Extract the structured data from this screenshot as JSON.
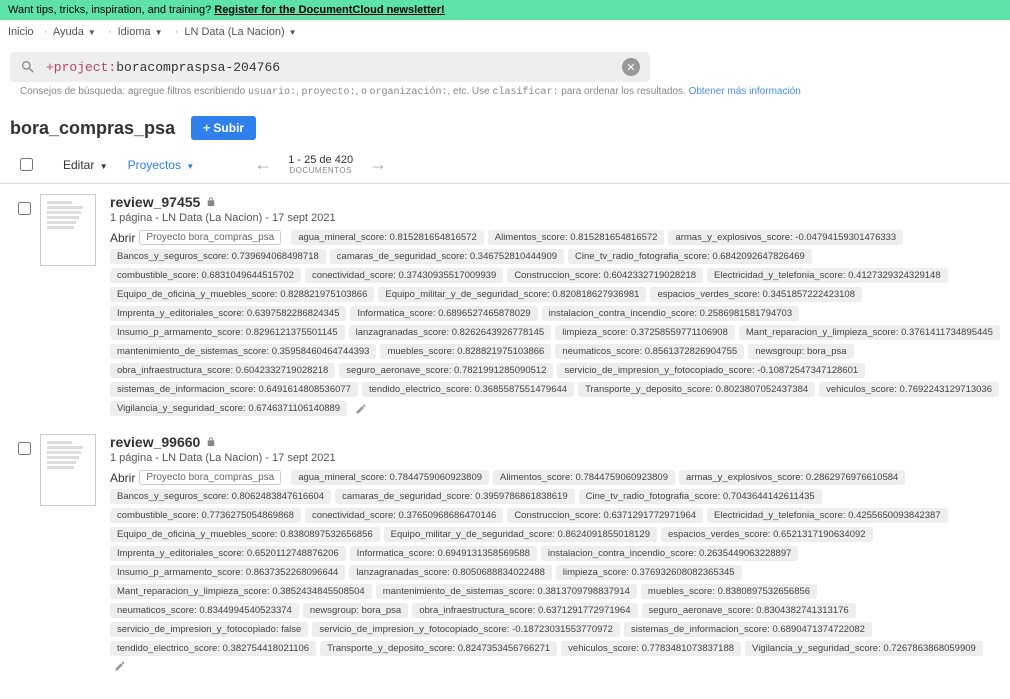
{
  "banner": {
    "text": "Want tips, tricks, inspiration, and training? ",
    "link": "Register for the DocumentCloud newsletter!"
  },
  "breadcrumb": {
    "home": "Inicio",
    "help": "Ayuda",
    "lang": "Idioma",
    "org": "LN Data (La Nacion)"
  },
  "search": {
    "prefix": "+project:",
    "value": "boracompraspsa-204766"
  },
  "hint": {
    "prefix": "Consejos de búsqueda: agregue filtros escribiendo ",
    "f1": "usuario:",
    "f2": "proyecto:",
    "mid": ", o ",
    "f3": "organización:",
    "mid2": ", etc. Use ",
    "f4": "clasificar:",
    "suffix": " para ordenar los resultados. ",
    "link": "Obtener más información"
  },
  "project": {
    "title": "bora_compras_psa",
    "upload": "+ Subir"
  },
  "toolbar": {
    "edit": "Editar",
    "projects": "Proyectos",
    "range": "1 - 25 de 420",
    "docs_label": "DOCUMENTOS"
  },
  "docs": [
    {
      "title": "review_97455",
      "meta": "1 página - LN Data (La Nacion) - 17 sept 2021",
      "open": "Abrir",
      "proj_label": "Proyecto",
      "proj_name": "bora_compras_psa",
      "tags": [
        "agua_mineral_score: 0.815281654816572",
        "Alimentos_score: 0.815281654816572",
        "armas_y_explosivos_score: -0.04794159301476333",
        "Bancos_y_seguros_score: 0.739694068498718",
        "camaras_de_seguridad_score: 0.346752810444909",
        "Cine_tv_radio_fotografia_score: 0.6842092647826469",
        "combustible_score: 0.6831049644515702",
        "conectividad_score: 0.37430935517009939",
        "Construccion_score: 0.6042332719028218",
        "Electricidad_y_telefonia_score: 0.4127329324329148",
        "Equipo_de_oficina_y_muebles_score: 0.828821975103866",
        "Equipo_militar_y_de_seguridad_score: 0.820818627936981",
        "espacios_verdes_score: 0.3451857222423108",
        "Imprenta_y_editoriales_score: 0.6397582286824345",
        "Informatica_score: 0.6896527465878029",
        "instalacion_contra_incendio_score: 0.2586981581794703",
        "Insumo_p_armamento_score: 0.8296121375501145",
        "lanzagranadas_score: 0.8262643926778145",
        "limpieza_score: 0.37258559771106908",
        "Mant_reparacion_y_limpieza_score: 0.3761411734895445",
        "mantenimiento_de_sistemas_score: 0.35958460464744393",
        "muebles_score: 0.828821975103866",
        "neumaticos_score: 0.8561372826904755",
        "newsgroup: bora_psa",
        "obra_infraestructura_score: 0.6042332719028218",
        "seguro_aeronave_score: 0.7821991285090512",
        "servicio_de_impresion_y_fotocopiado_score: -0.10872547347128601",
        "sistemas_de_informacion_score: 0.6491614808536077",
        "tendido_electrico_score: 0.3685587551479644",
        "Transporte_y_deposito_score: 0.8023807052437384",
        "vehiculos_score: 0.7692243129713036",
        "Vigilancia_y_seguridad_score: 0.6746371106140889"
      ]
    },
    {
      "title": "review_99660",
      "meta": "1 página - LN Data (La Nacion) - 17 sept 2021",
      "open": "Abrir",
      "proj_label": "Proyecto",
      "proj_name": "bora_compras_psa",
      "tags": [
        "agua_mineral_score: 0.7844759060923809",
        "Alimentos_score: 0.7844759060923809",
        "armas_y_explosivos_score: 0.2862976976610584",
        "Bancos_y_seguros_score: 0.8062483847616604",
        "camaras_de_seguridad_score: 0.3959786861838619",
        "Cine_tv_radio_fotografia_score: 0.7043644142611435",
        "combustible_score: 0.7736275054869868",
        "conectividad_score: 0.37650968686470146",
        "Construccion_score: 0.6371291772971964",
        "Electricidad_y_telefonia_score: 0.4255650093842387",
        "Equipo_de_oficina_y_muebles_score: 0.8380897532656856",
        "Equipo_militar_y_de_seguridad_score: 0.8624091855018129",
        "espacios_verdes_score: 0.6521317190634092",
        "Imprenta_y_editoriales_score: 0.6520112748876206",
        "Informatica_score: 0.6949131358569588",
        "instalacion_contra_incendio_score: 0.2635449063228897",
        "Insumo_p_armamento_score: 0.8637352268096644",
        "lanzagranadas_score: 0.8050688834022488",
        "limpieza_score: 0.376932608082365345",
        "Mant_reparacion_y_limpieza_score: 0.3852434845508504",
        "mantenimiento_de_sistemas_score: 0.3813709798837914",
        "muebles_score: 0.8380897532656856",
        "neumaticos_score: 0.8344994540523374",
        "newsgroup: bora_psa",
        "obra_infraestructura_score: 0.6371291772971964",
        "seguro_aeronave_score: 0.8304382741313176",
        "servicio_de_impresion_y_fotocopiado: false",
        "servicio_de_impresion_y_fotocopiado_score: -0.18723031553770972",
        "sistemas_de_informacion_score: 0.6890471374722082",
        "tendido_electrico_score: 0.382754418021106",
        "Transporte_y_deposito_score: 0.8247353456766271",
        "vehiculos_score: 0.7783481073837188",
        "Vigilancia_y_seguridad_score: 0.7267863868059909"
      ]
    }
  ]
}
